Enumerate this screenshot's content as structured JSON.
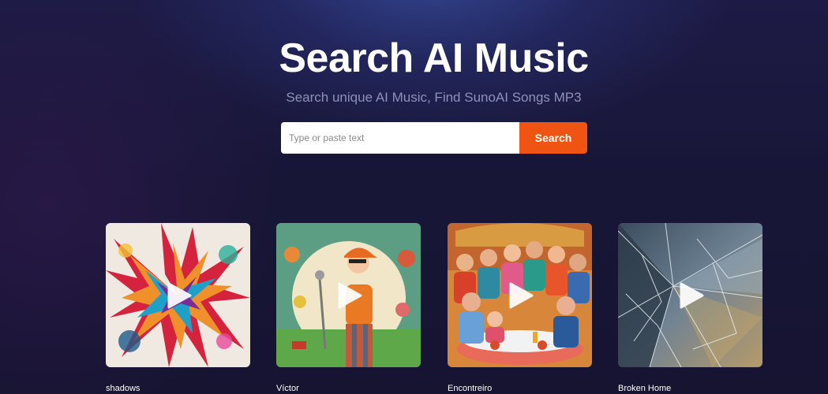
{
  "hero": {
    "title": "Search AI Music",
    "subtitle": "Search unique AI Music, Find SunoAI Songs MP3"
  },
  "search": {
    "placeholder": "Type or paste text",
    "button_label": "Search"
  },
  "songs": [
    {
      "title": "shadows"
    },
    {
      "title": "Víctor"
    },
    {
      "title": "Encontreiro"
    },
    {
      "title": "Broken Home"
    }
  ],
  "colors": {
    "accent": "#f05412",
    "background": "#171531",
    "subtitle": "#8f91b8"
  }
}
